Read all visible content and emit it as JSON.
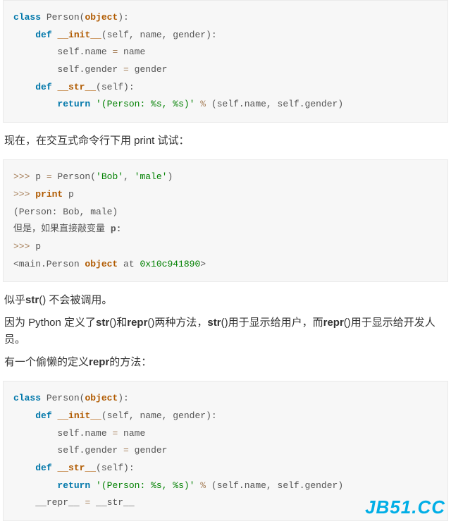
{
  "code1": {
    "l1a": "class",
    "l1b": " Person(",
    "l1c": "object",
    "l1d": "):",
    "l2a": "def",
    "l2b": " ",
    "l2c": "__init__",
    "l2d": "(self, name, gender):",
    "l3a": "self.name ",
    "l3b": "=",
    "l3c": " name",
    "l4a": "self.gender ",
    "l4b": "=",
    "l4c": " gender",
    "l5a": "def",
    "l5b": " ",
    "l5c": "__str__",
    "l5d": "(self):",
    "l6a": "return",
    "l6b": " ",
    "l6c": "'(Person: %s, %s)'",
    "l6d": " ",
    "l6e": "%",
    "l6f": " (self.name, self.gender)"
  },
  "para1": "现在，在交互式命令行下用 print 试试：",
  "code2": {
    "l1a": ">>>",
    "l1b": " p ",
    "l1c": "=",
    "l1d": " Person(",
    "l1e": "'Bob'",
    "l1f": ", ",
    "l1g": "'male'",
    "l1h": ")",
    "l2a": ">>>",
    "l2b": " ",
    "l2c": "print",
    "l2d": " p",
    "l3": "(Person: Bob, male)",
    "l4a": "但是，如果直接敲变量 ",
    "l4b": "p:",
    "l5a": ">>>",
    "l5b": " p",
    "l6a": "<main.Person ",
    "l6b": "object",
    "l6c": " at ",
    "l6d": "0x10c941890",
    "l6e": ">"
  },
  "para2a": "似乎",
  "para2b": "str",
  "para2c": "() 不会被调用。",
  "para3a": "因为 Python 定义了",
  "para3b": "str",
  "para3c": "()和",
  "para3d": "repr",
  "para3e": "()两种方法，",
  "para3f": "str",
  "para3g": "()用于显示给用户，而",
  "para3h": "repr",
  "para3i": "()用于显示给开发人员。",
  "para4a": "有一个偷懒的定义",
  "para4b": "repr",
  "para4c": "的方法：",
  "code3": {
    "l1a": "class",
    "l1b": " Person(",
    "l1c": "object",
    "l1d": "):",
    "l2a": "def",
    "l2b": " ",
    "l2c": "__init__",
    "l2d": "(self, name, gender):",
    "l3a": "self.name ",
    "l3b": "=",
    "l3c": " name",
    "l4a": "self.gender ",
    "l4b": "=",
    "l4c": " gender",
    "l5a": "def",
    "l5b": " ",
    "l5c": "__str__",
    "l5d": "(self):",
    "l6a": "return",
    "l6b": " ",
    "l6c": "'(Person: %s, %s)'",
    "l6d": " ",
    "l6e": "%",
    "l6f": " (self.name, self.gender)",
    "l7a": "__repr__ ",
    "l7b": "=",
    "l7c": " __str__"
  },
  "watermark": "JB51.CC"
}
